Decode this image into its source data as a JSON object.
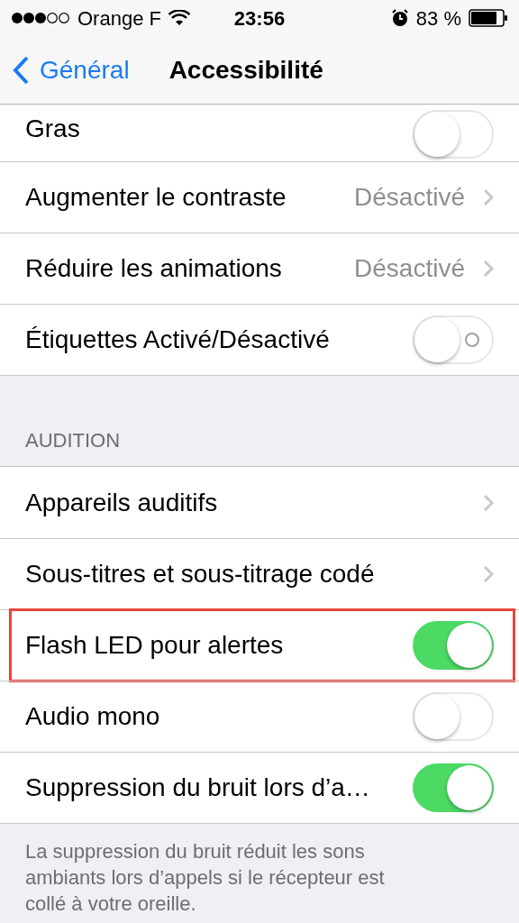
{
  "status_bar": {
    "carrier": "Orange F",
    "time": "23:56",
    "battery": "83 %"
  },
  "nav_bar": {
    "back": "Général",
    "title": "Accessibilité"
  },
  "groups": [
    {
      "rows": [
        {
          "kind": "toggle",
          "label": "Gras",
          "on": false,
          "clipped": true
        },
        {
          "kind": "disclosure",
          "label": "Augmenter le contraste",
          "value": "Désactivé"
        },
        {
          "kind": "disclosure",
          "label": "Réduire les animations",
          "value": "Désactivé"
        },
        {
          "kind": "toggle",
          "label": "Étiquettes Activé/Désactivé",
          "on": false,
          "onoff_labels": true
        }
      ]
    },
    {
      "header": "AUDITION",
      "rows": [
        {
          "kind": "disclosure",
          "label": "Appareils auditifs"
        },
        {
          "kind": "disclosure",
          "label": "Sous-titres et sous-titrage codé"
        },
        {
          "kind": "toggle",
          "label": "Flash LED pour alertes",
          "on": true,
          "highlighted": true
        },
        {
          "kind": "toggle",
          "label": "Audio mono",
          "on": false
        },
        {
          "kind": "toggle",
          "label": "Suppression du bruit lors d’a…",
          "on": true
        }
      ],
      "footer": "La suppression du bruit réduit les sons ambiants lors d’appels si le récepteur est collé à votre oreille."
    }
  ]
}
